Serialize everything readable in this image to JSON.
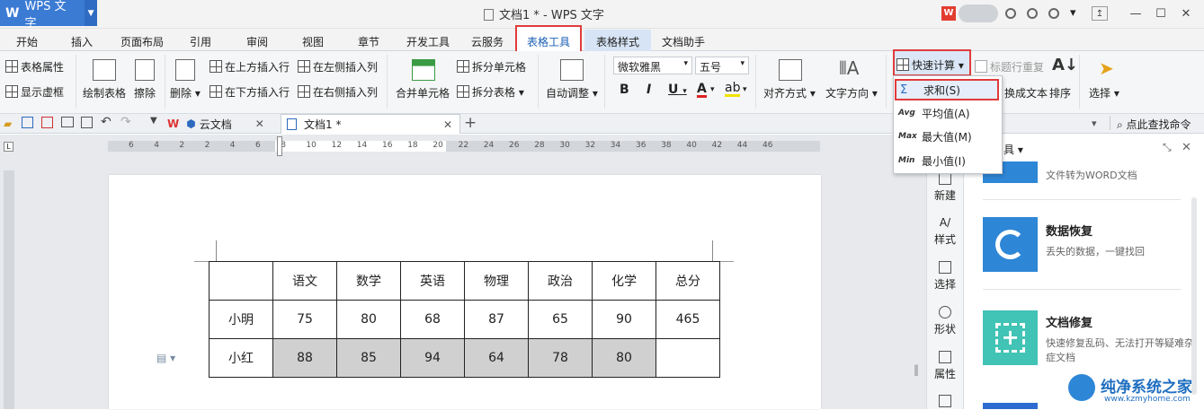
{
  "app": {
    "logo": "W",
    "name": "WPS 文字",
    "title": "文档1 * - WPS 文字"
  },
  "tabs": [
    "开始",
    "插入",
    "页面布局",
    "引用",
    "审阅",
    "视图",
    "章节",
    "开发工具",
    "云服务",
    "表格工具",
    "表格样式",
    "文档助手"
  ],
  "ribbon": {
    "table_props": "表格属性",
    "show_grid": "显示虚框",
    "draw_table": "绘制表格",
    "erase": "擦除",
    "delete": "删除",
    "insert_above": "在上方插入行",
    "insert_below": "在下方插入行",
    "insert_left": "在左侧插入列",
    "insert_right": "在右侧插入列",
    "merge_cells": "合并单元格",
    "split_cells": "拆分单元格",
    "split_table": "拆分表格",
    "auto_adjust": "自动调整",
    "font_name": "微软雅黑",
    "font_size": "五号",
    "bold": "B",
    "italic": "I",
    "underline": "U",
    "align": "对齐方式",
    "text_dir": "文字方向",
    "quick_calc": "快速计算",
    "repeat_header": "标题行重复",
    "to_text": "换成文本",
    "sort": "排序",
    "select": "选择"
  },
  "quick_calc_menu": [
    {
      "icon": "Σ",
      "label": "求和(S)"
    },
    {
      "icon": "Avg",
      "label": "平均值(A)"
    },
    {
      "icon": "Max",
      "label": "最大值(M)"
    },
    {
      "icon": "Min",
      "label": "最小值(I)"
    }
  ],
  "doc_tabs": {
    "cloud": "云文档",
    "doc1": "文档1 *"
  },
  "find_cmd": "点此查找命令",
  "ruler_marks": [
    "6",
    "4",
    "2",
    "2",
    "4",
    "6",
    "8",
    "10",
    "12",
    "14",
    "16",
    "18",
    "20",
    "22",
    "24",
    "26",
    "28",
    "30",
    "32",
    "34",
    "36",
    "38",
    "40",
    "42",
    "44",
    "46"
  ],
  "table": {
    "header": [
      "",
      "语文",
      "数学",
      "英语",
      "物理",
      "政治",
      "化学",
      "总分"
    ],
    "rows": [
      [
        "小明",
        "75",
        "80",
        "68",
        "87",
        "65",
        "90",
        "465"
      ],
      [
        "小红",
        "88",
        "85",
        "94",
        "64",
        "78",
        "80",
        ""
      ]
    ]
  },
  "side_tools": [
    "新建",
    "样式",
    "选择",
    "形状",
    "属性"
  ],
  "panel": {
    "header": "具",
    "cards": [
      {
        "title": "",
        "desc": "文件转为WORD文档"
      },
      {
        "title": "数据恢复",
        "desc": "丢失的数据，一键找回"
      },
      {
        "title": "文档修复",
        "desc": "快速修复乱码、无法打开等疑难杂症文档"
      }
    ]
  },
  "watermark": {
    "title": "纯净系统之家",
    "url": "www.kzmyhome.com"
  }
}
